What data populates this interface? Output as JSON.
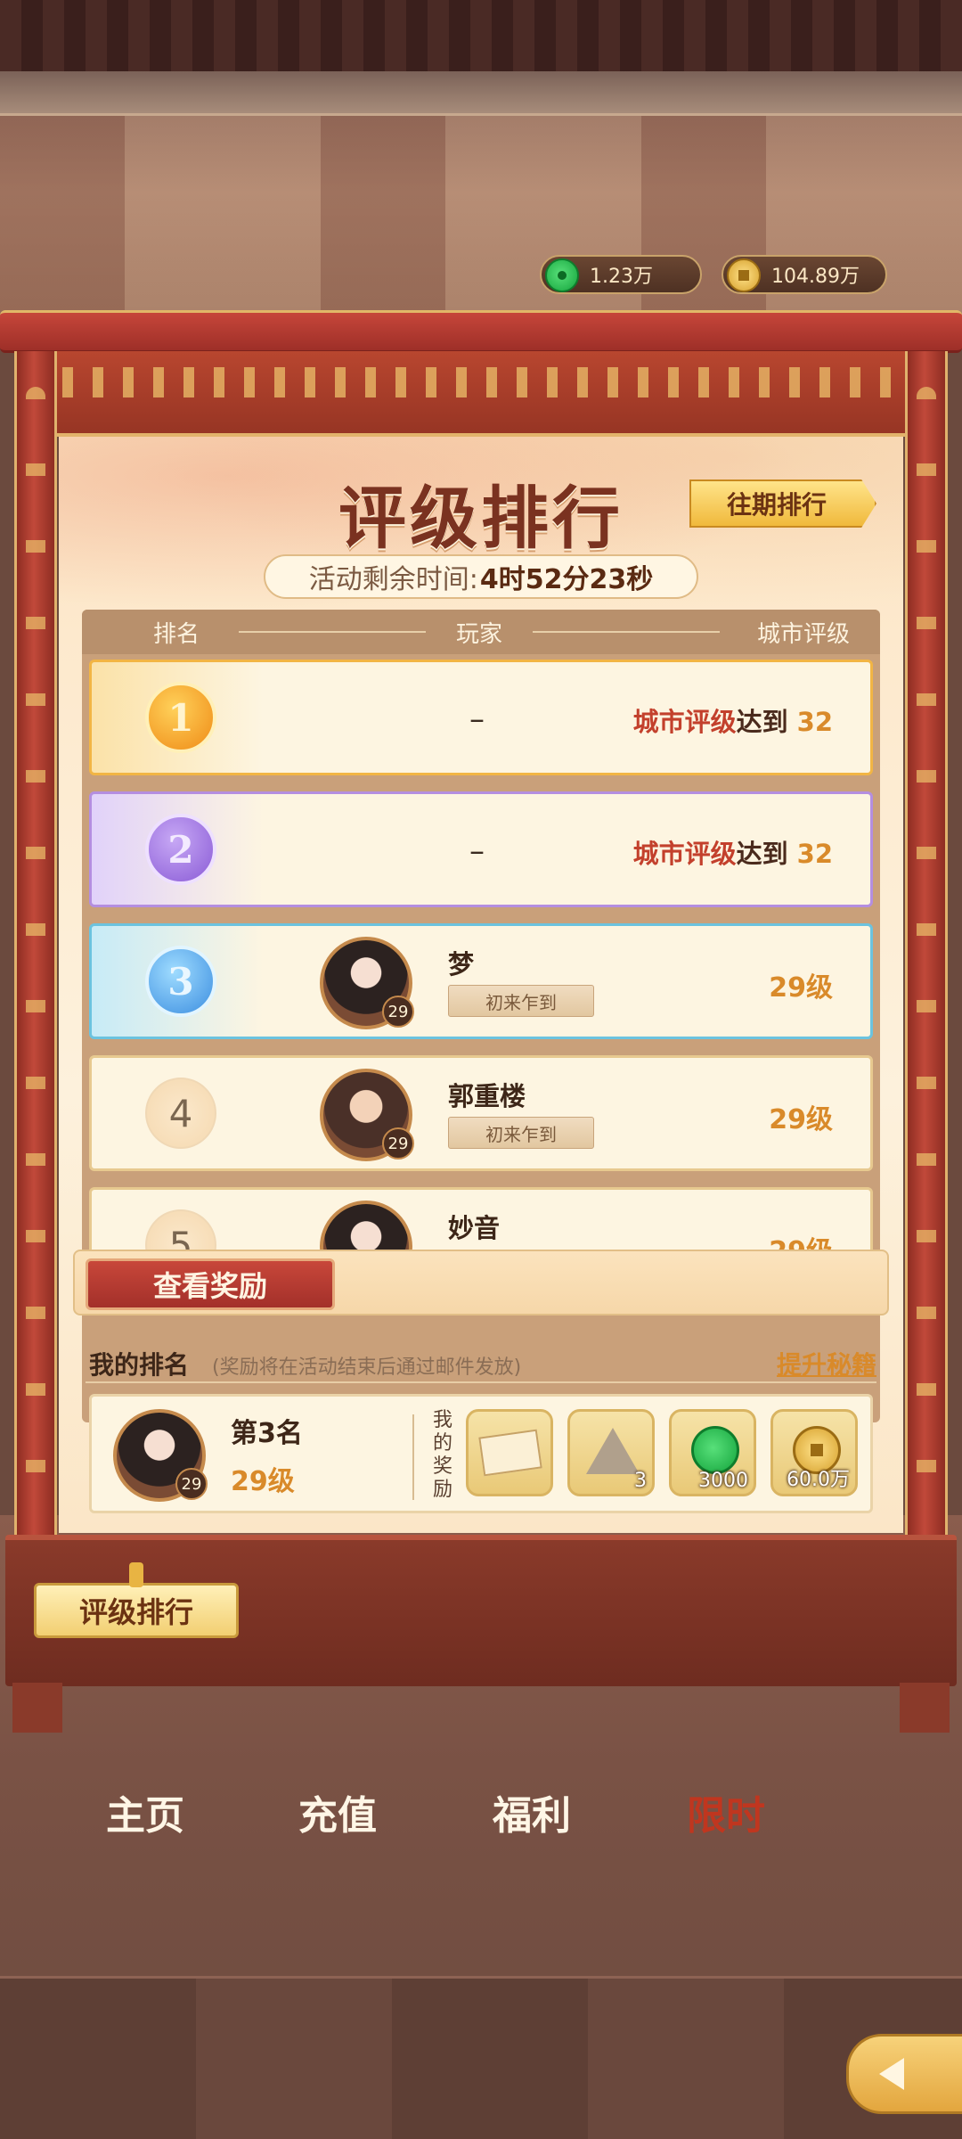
{
  "currency": {
    "jade": {
      "value": "1.23万",
      "icon": "jade-coin-icon"
    },
    "gold": {
      "value": "104.89万",
      "icon": "copper-coin-icon"
    }
  },
  "panel": {
    "title": "评级排行",
    "history_button": "往期排行",
    "timer_label": "活动剩余时间:",
    "timer_value": "4时52分23秒"
  },
  "table": {
    "headers": {
      "rank": "排名",
      "player": "玩家",
      "rating": "城市评级"
    },
    "rows": [
      {
        "rank": "1",
        "player": "–",
        "req_a": "城市评级",
        "req_b": "达到",
        "req_value": "32"
      },
      {
        "rank": "2",
        "player": "–",
        "req_a": "城市评级",
        "req_b": "达到",
        "req_value": "32"
      },
      {
        "rank": "3",
        "name": "梦",
        "tag": "初来乍到",
        "avatar_level": "29",
        "level": "29级"
      },
      {
        "rank": "4",
        "name": "郭重楼",
        "tag": "初来乍到",
        "avatar_level": "29",
        "level": "29级"
      },
      {
        "rank": "5",
        "name": "妙音",
        "level": "29级"
      }
    ]
  },
  "reward_button": "查看奖励",
  "my_rank": {
    "title": "我的排名",
    "note": "(奖励将在活动结束后通过邮件发放)",
    "tip_link": "提升秘籍",
    "rank_text": "第3名",
    "level": "29级",
    "avatar_level": "29",
    "reward_label": "我的奖励",
    "rewards": [
      {
        "icon": "title-card-icon",
        "count": ""
      },
      {
        "icon": "tent-icon",
        "count": "3"
      },
      {
        "icon": "jade-coin-icon",
        "count": "3000"
      },
      {
        "icon": "copper-coin-icon",
        "count": "60.0万"
      }
    ]
  },
  "active_tab": "评级排行",
  "nav": [
    {
      "label": "主页",
      "active": false
    },
    {
      "label": "充值",
      "active": false
    },
    {
      "label": "福利",
      "active": false
    },
    {
      "label": "限时",
      "active": true
    }
  ],
  "colors": {
    "accent_red": "#c3402c",
    "accent_orange": "#d98a2a",
    "frame_red": "#b8462f"
  }
}
